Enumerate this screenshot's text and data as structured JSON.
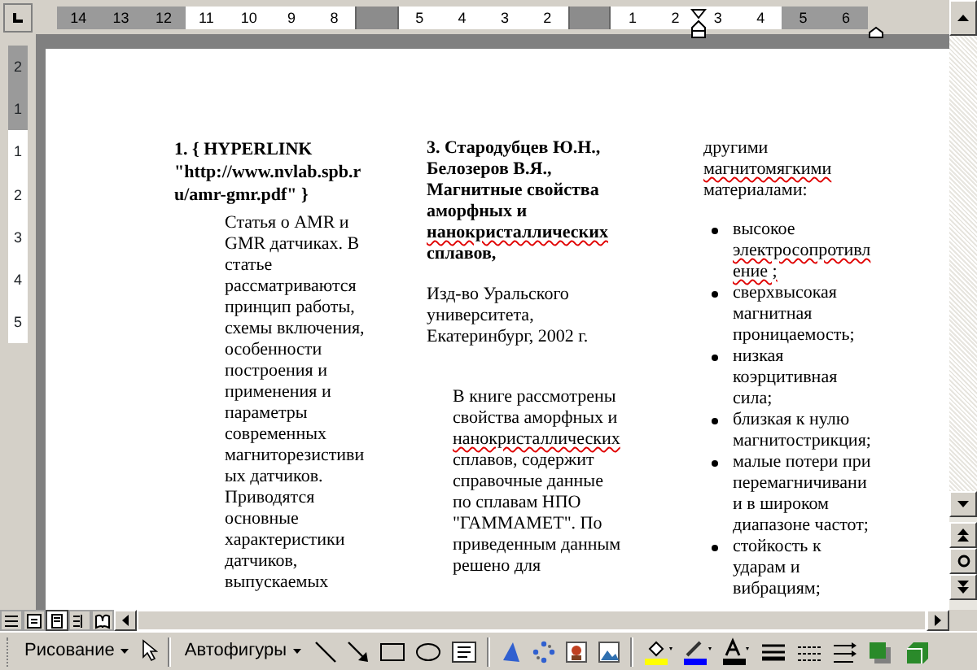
{
  "ruler": {
    "horizontal": [
      {
        "kind": "number",
        "label": "14",
        "shaded": true
      },
      {
        "kind": "number",
        "label": "13",
        "shaded": true
      },
      {
        "kind": "number",
        "label": "12",
        "shaded": true
      },
      {
        "kind": "number",
        "label": "11",
        "shaded": false
      },
      {
        "kind": "number",
        "label": "10",
        "shaded": false
      },
      {
        "kind": "number",
        "label": "9",
        "shaded": false
      },
      {
        "kind": "number",
        "label": "8",
        "shaded": false
      },
      {
        "kind": "margin"
      },
      {
        "kind": "number",
        "label": "5",
        "shaded": false
      },
      {
        "kind": "number",
        "label": "4",
        "shaded": false
      },
      {
        "kind": "number",
        "label": "3",
        "shaded": false
      },
      {
        "kind": "number",
        "label": "2",
        "shaded": false
      },
      {
        "kind": "margin"
      },
      {
        "kind": "number",
        "label": "1",
        "shaded": false
      },
      {
        "kind": "number",
        "label": "2",
        "shaded": false
      },
      {
        "kind": "number",
        "label": "3",
        "shaded": false
      },
      {
        "kind": "number",
        "label": "4",
        "shaded": false
      },
      {
        "kind": "number",
        "label": "5",
        "shaded": true
      },
      {
        "kind": "number",
        "label": "6",
        "shaded": true
      }
    ],
    "vertical": [
      {
        "label": "2",
        "shaded": true
      },
      {
        "label": "1",
        "shaded": true
      },
      {
        "label": "1",
        "shaded": false
      },
      {
        "label": "2",
        "shaded": false
      },
      {
        "label": "3",
        "shaded": false
      },
      {
        "label": "4",
        "shaded": false
      },
      {
        "label": "5",
        "shaded": false
      }
    ]
  },
  "document": {
    "columns": [
      {
        "blocks": [
          {
            "kind": "heading",
            "lines": [
              {
                "text": "1. { HYPERLINK",
                "misspelled": false
              },
              {
                "text": "\"http://www.nvlab.spb.r",
                "misspelled": false
              },
              {
                "text": "u/amr-gmr.pdf\" }",
                "misspelled": false
              }
            ]
          },
          {
            "kind": "indented",
            "lines": [
              {
                "text": "Статья о AMR и",
                "misspelled": false
              },
              {
                "text": "GMR датчиках. В",
                "misspelled": false
              },
              {
                "text": "статье",
                "misspelled": false
              },
              {
                "text": "рассматриваются",
                "misspelled": false
              },
              {
                "text": "принцип работы,",
                "misspelled": false
              },
              {
                "text": "схемы включения,",
                "misspelled": false
              },
              {
                "text": "особенности",
                "misspelled": false
              },
              {
                "text": "построения и",
                "misspelled": false
              },
              {
                "text": "применения и",
                "misspelled": false
              },
              {
                "text": "параметры",
                "misspelled": false
              },
              {
                "text": "современных",
                "misspelled": false
              },
              {
                "text": "магниторезистиви",
                "misspelled": false
              },
              {
                "text": "ых датчиков.",
                "misspelled": false
              },
              {
                "text": "Приводятся",
                "misspelled": false
              },
              {
                "text": "основные",
                "misspelled": false
              },
              {
                "text": "характеристики",
                "misspelled": false
              },
              {
                "text": "датчиков,",
                "misspelled": false
              },
              {
                "text": "выпускаемых",
                "misspelled": false
              }
            ]
          }
        ]
      },
      {
        "blocks": [
          {
            "kind": "heading",
            "lines": [
              {
                "text": "3. Стародубцев Ю.Н.,",
                "misspelled": false
              },
              {
                "text": "Белозеров В.Я.,",
                "misspelled": false
              },
              {
                "text": "Магнитные свойства",
                "misspelled": false
              },
              {
                "text": "аморфных и",
                "misspelled": false
              },
              {
                "text": "нанокристаллических",
                "misspelled": true
              },
              {
                "text": "сплавов,",
                "misspelled": false
              }
            ]
          },
          {
            "kind": "paragraph",
            "lines": [
              {
                "text": " Изд-во Уральского",
                "misspelled": false
              },
              {
                "text": "университета,",
                "misspelled": false
              },
              {
                "text": "Екатеринбург, 2002 г.",
                "misspelled": false
              }
            ]
          },
          {
            "kind": "indented",
            "lines": [
              {
                "text": "В книге рассмотрены",
                "misspelled": false
              },
              {
                "text": "свойства аморфных и",
                "misspelled": false
              },
              {
                "text": "нанокристаллических",
                "misspelled": true
              },
              {
                "text": "сплавов, содержит",
                "misspelled": false
              },
              {
                "text": "справочные данные",
                "misspelled": false
              },
              {
                "text": "по сплавам НПО",
                "misspelled": false
              },
              {
                "text": "\"ГАММАМЕТ\". По",
                "misspelled": false
              },
              {
                "text": "приведенным данным",
                "misspelled": false
              },
              {
                "text": "решено для",
                "misspelled": false
              }
            ]
          }
        ]
      },
      {
        "blocks": [
          {
            "kind": "paragraph",
            "lines": [
              {
                "text": "другими",
                "misspelled": false
              },
              {
                "text": "магнитомягкими",
                "misspelled": true
              },
              {
                "text": "материалами:",
                "misspelled": false
              }
            ]
          },
          {
            "kind": "bullet",
            "lines": [
              {
                "text": "высокое",
                "misspelled": false
              },
              {
                "text": "электросопротивл",
                "misspelled": true
              },
              {
                "text": "ение ;",
                "misspelled": true
              }
            ]
          },
          {
            "kind": "bullet",
            "lines": [
              {
                "text": "сверхвысокая",
                "misspelled": false
              },
              {
                "text": "магнитная",
                "misspelled": false
              },
              {
                "text": "проницаемость;",
                "misspelled": false
              }
            ]
          },
          {
            "kind": "bullet",
            "lines": [
              {
                "text": "низкая",
                "misspelled": false
              },
              {
                "text": "коэрцитивная",
                "misspelled": false
              },
              {
                "text": "сила;",
                "misspelled": false
              }
            ]
          },
          {
            "kind": "bullet",
            "lines": [
              {
                "text": "близкая к нулю",
                "misspelled": false
              },
              {
                "text": "магнитострикция;",
                "misspelled": false
              }
            ]
          },
          {
            "kind": "bullet",
            "lines": [
              {
                "text": "малые потери при",
                "misspelled": false
              },
              {
                "text": "перемагничивани",
                "misspelled": false
              },
              {
                "text": "и в широком",
                "misspelled": false
              },
              {
                "text": "диапазоне частот;",
                "misspelled": false
              }
            ]
          },
          {
            "kind": "bullet",
            "lines": [
              {
                "text": "стойкость к",
                "misspelled": false
              },
              {
                "text": "ударам и",
                "misspelled": false
              },
              {
                "text": "вибрациям;",
                "misspelled": false
              }
            ]
          }
        ]
      }
    ]
  },
  "drawing_toolbar": {
    "draw_menu": "Рисование",
    "autoshapes_menu": "Автофигуры"
  }
}
